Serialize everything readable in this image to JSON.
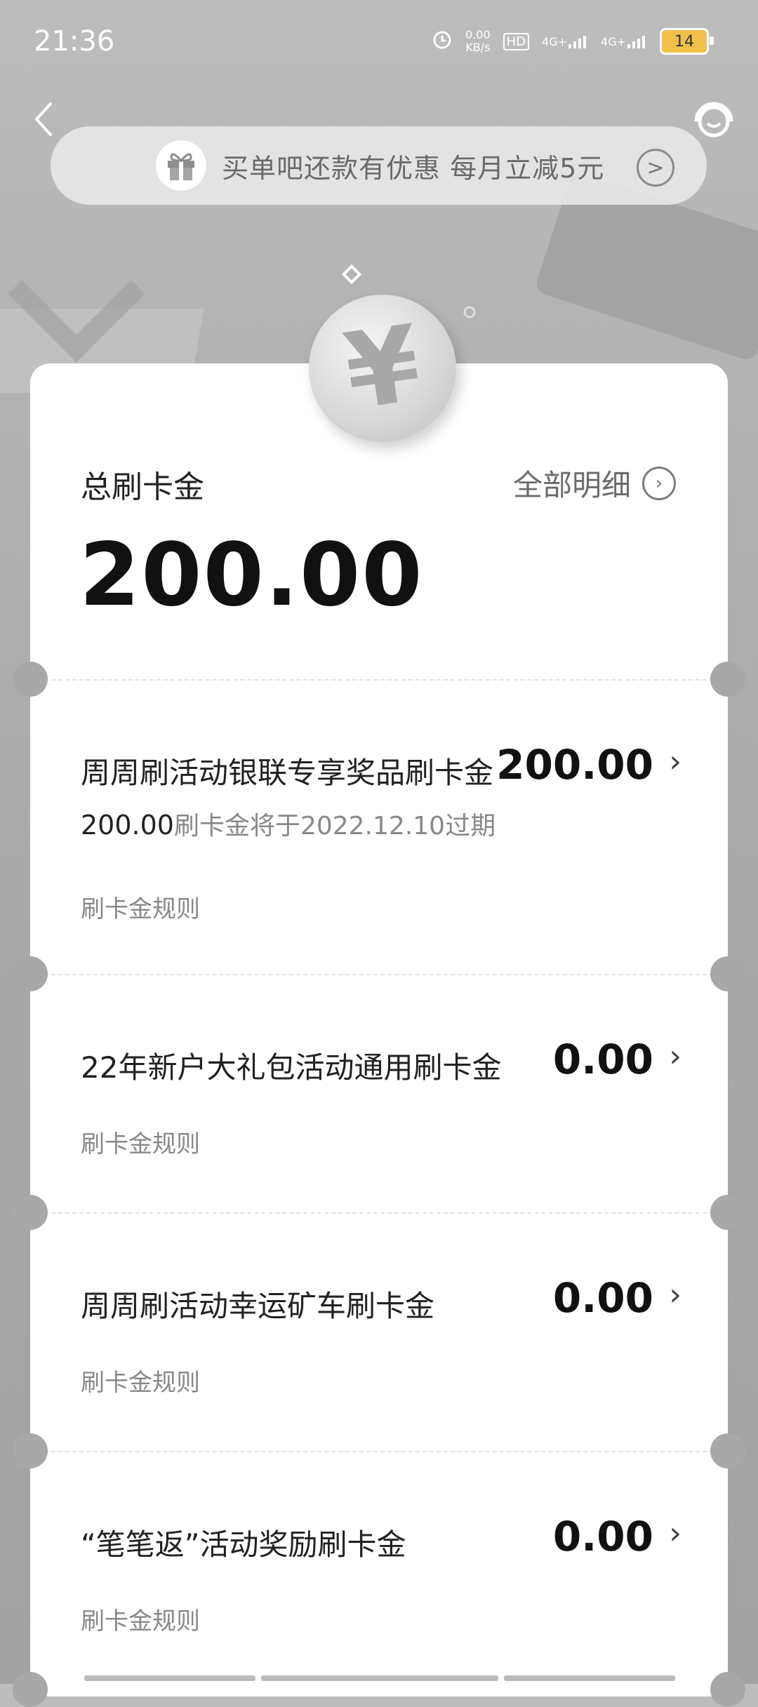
{
  "status_bar": {
    "time": "21:36",
    "net_speed_value": "0.00",
    "net_speed_unit": "KB/s",
    "hd_label": "HD",
    "sim1_label": "4G+",
    "sim2_label": "4G+",
    "battery": "14"
  },
  "banner": {
    "text": "买单吧还款有优惠 每月立减5元",
    "arrow": ">"
  },
  "summary": {
    "label": "总刷卡金",
    "details_link": "全部明细",
    "amount": "200.00"
  },
  "items": [
    {
      "title": "周周刷活动银联专享奖品刷卡金",
      "amount": "200.00",
      "sub_amount": "200.00",
      "sub_text": "刷卡金将于2022.12.10过期",
      "rule": "刷卡金规则"
    },
    {
      "title": "22年新户大礼包活动通用刷卡金",
      "amount": "0.00",
      "rule": "刷卡金规则"
    },
    {
      "title": "周周刷活动幸运矿车刷卡金",
      "amount": "0.00",
      "rule": "刷卡金规则"
    },
    {
      "title": "“笔笔返”活动奖励刷卡金",
      "amount": "0.00",
      "rule": "刷卡金规则"
    }
  ],
  "chevron": "›",
  "coin_symbol": "¥"
}
